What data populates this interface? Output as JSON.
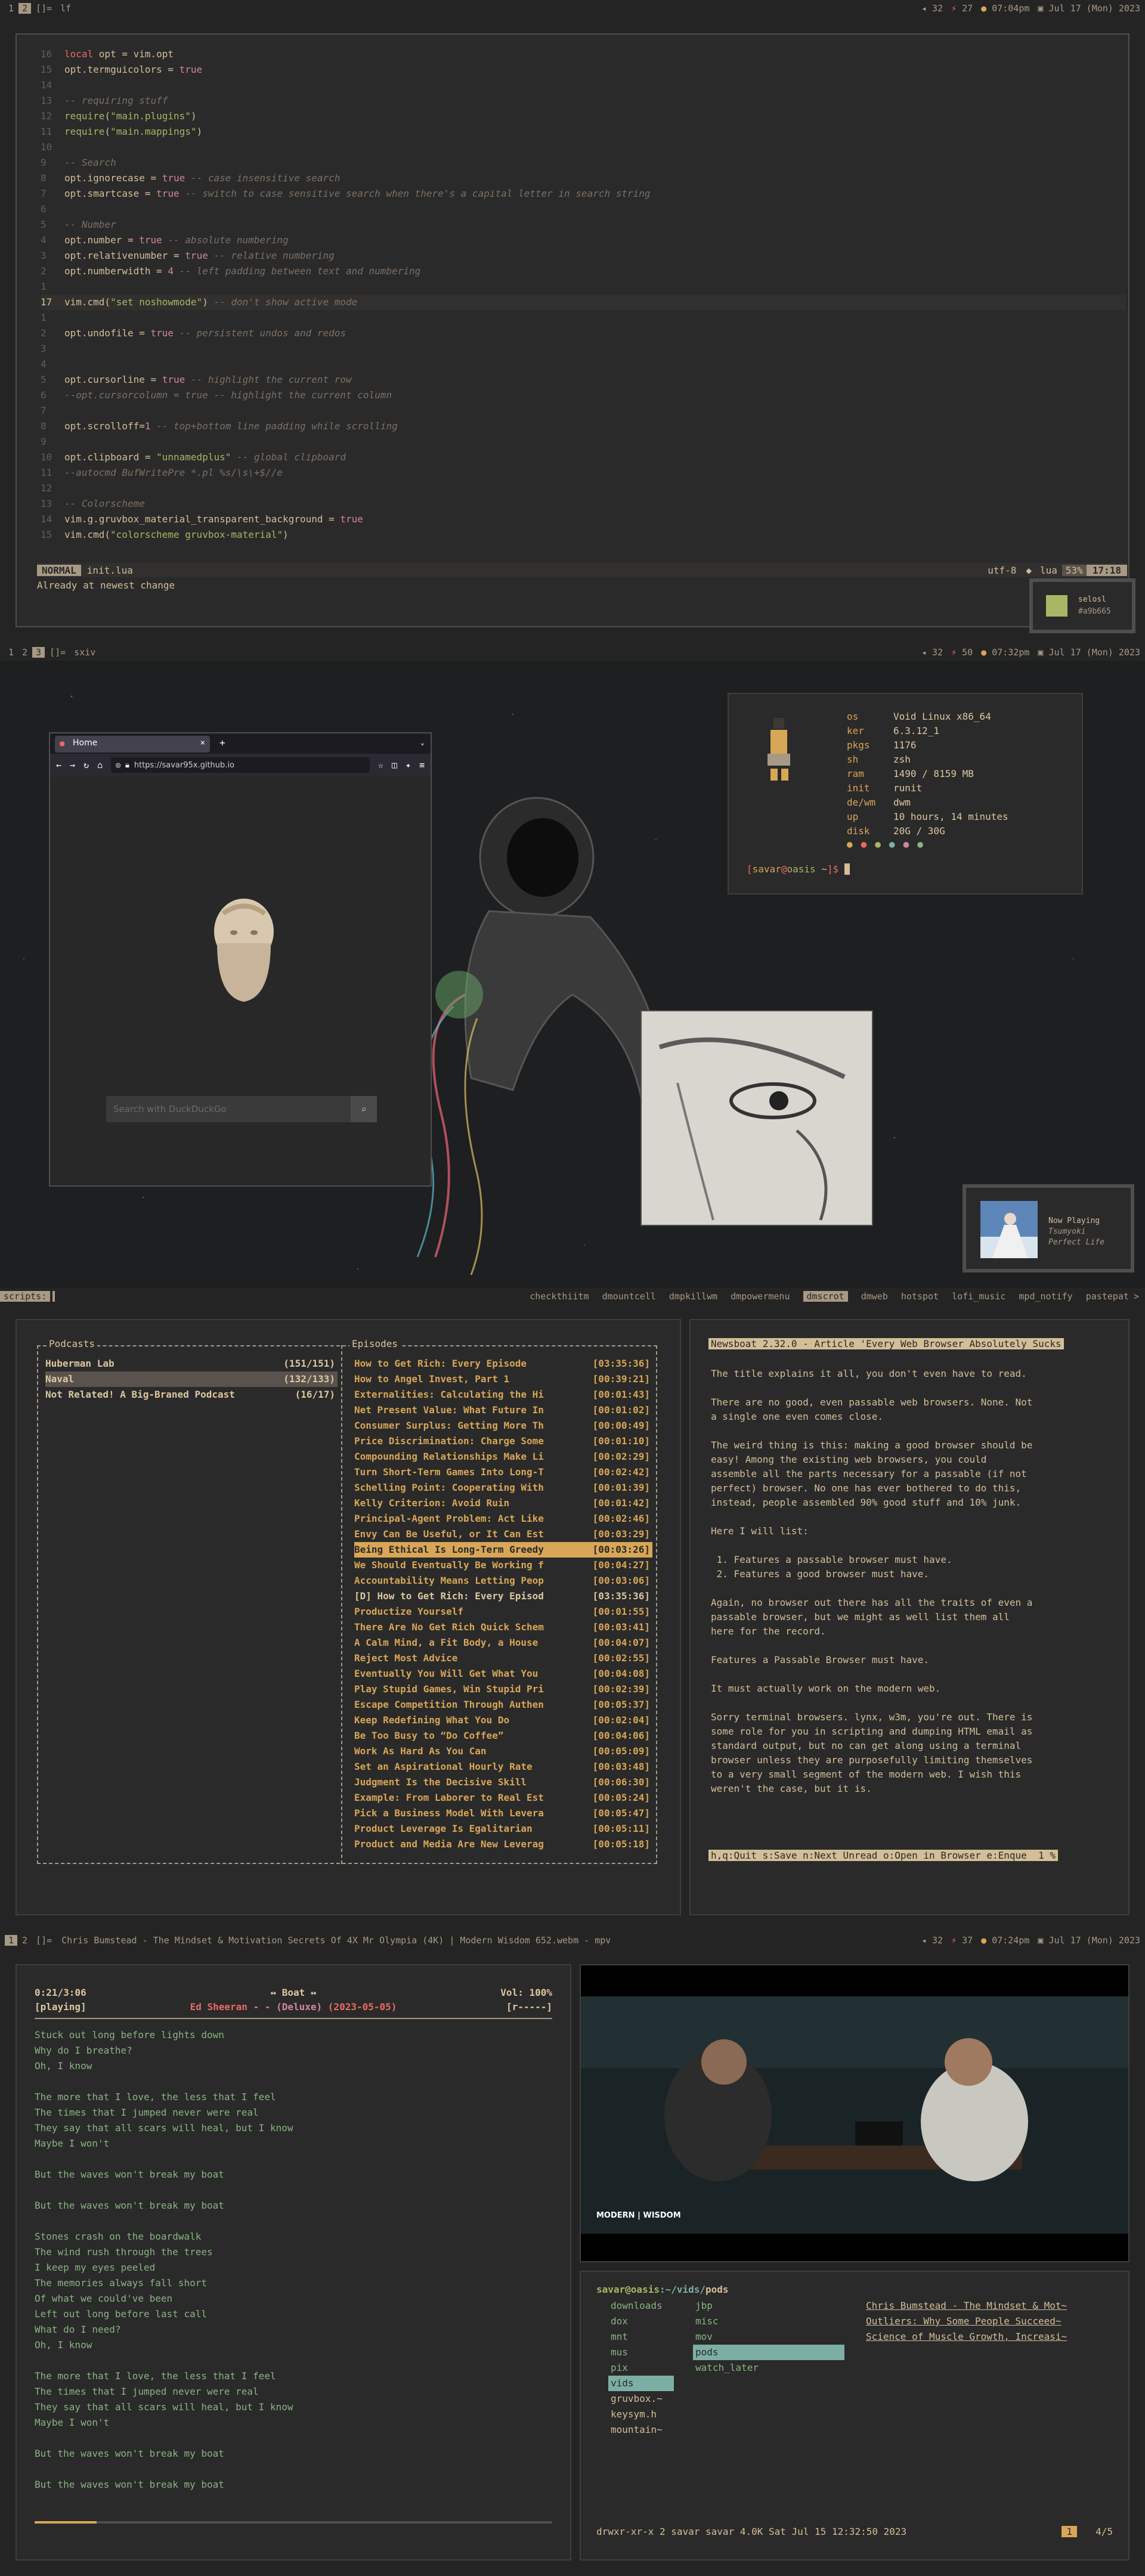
{
  "bar1": {
    "tags": [
      "1",
      "2",
      "[]=",
      "lf"
    ],
    "active": 1,
    "updates": "32",
    "cpu": "27",
    "time": "07:04pm",
    "date": "Jul 17 (Mon) 2023"
  },
  "nvim": {
    "lines": [
      {
        "n": "16",
        "t": [
          [
            "kw",
            "local "
          ],
          [
            "tx",
            "opt = vim.opt"
          ]
        ]
      },
      {
        "n": "15",
        "t": [
          [
            "tx",
            "opt.termguicolors = "
          ],
          [
            "nm",
            "true"
          ]
        ]
      },
      {
        "n": "14",
        "t": []
      },
      {
        "n": "13",
        "t": [
          [
            "cm",
            "-- requiring stuff"
          ]
        ]
      },
      {
        "n": "12",
        "t": [
          [
            "fn",
            "require"
          ],
          [
            "tx",
            "("
          ],
          [
            "str",
            "\"main.plugins\""
          ],
          [
            "tx",
            ")"
          ]
        ]
      },
      {
        "n": "11",
        "t": [
          [
            "fn",
            "require"
          ],
          [
            "tx",
            "("
          ],
          [
            "str",
            "\"main.mappings\""
          ],
          [
            "tx",
            ")"
          ]
        ]
      },
      {
        "n": "10",
        "t": []
      },
      {
        "n": "9",
        "t": [
          [
            "cm",
            "-- Search"
          ]
        ]
      },
      {
        "n": "8",
        "t": [
          [
            "tx",
            "opt.ignorecase = "
          ],
          [
            "nm",
            "true"
          ],
          [
            "cm",
            " -- case insensitive search"
          ]
        ]
      },
      {
        "n": "7",
        "t": [
          [
            "tx",
            "opt.smartcase = "
          ],
          [
            "nm",
            "true"
          ],
          [
            "cm",
            " -- switch to case sensitive search when there's a capital letter in search string"
          ]
        ]
      },
      {
        "n": "6",
        "t": []
      },
      {
        "n": "5",
        "t": [
          [
            "cm",
            "-- Number"
          ]
        ]
      },
      {
        "n": "4",
        "t": [
          [
            "tx",
            "opt.number = "
          ],
          [
            "nm",
            "true"
          ],
          [
            "cm",
            " -- absolute numbering"
          ]
        ]
      },
      {
        "n": "3",
        "t": [
          [
            "tx",
            "opt.relativenumber = "
          ],
          [
            "nm",
            "true"
          ],
          [
            "cm",
            " -- relative numbering"
          ]
        ]
      },
      {
        "n": "2",
        "t": [
          [
            "tx",
            "opt.numberwidth = "
          ],
          [
            "nm",
            "4"
          ],
          [
            "cm",
            " -- left padding between text and numbering"
          ]
        ]
      },
      {
        "n": "1",
        "t": []
      },
      {
        "n": "17",
        "t": [
          [
            "tx",
            "vim.cmd("
          ],
          [
            "str",
            "\"set noshowmode\""
          ],
          [
            "tx",
            ")"
          ],
          [
            "cm",
            " -- don't show active mode"
          ]
        ]
      },
      {
        "n": "1",
        "t": []
      },
      {
        "n": "2",
        "t": [
          [
            "tx",
            "opt.undofile = "
          ],
          [
            "nm",
            "true"
          ],
          [
            "cm",
            " -- persistent undos and redos"
          ]
        ]
      },
      {
        "n": "3",
        "t": []
      },
      {
        "n": "4",
        "t": []
      },
      {
        "n": "5",
        "t": [
          [
            "tx",
            "opt.cursorline = "
          ],
          [
            "nm",
            "true"
          ],
          [
            "cm",
            " -- highlight the current row"
          ]
        ]
      },
      {
        "n": "6",
        "t": [
          [
            "cm",
            "--opt.cursorcolumn = true -- highlight the current column"
          ]
        ]
      },
      {
        "n": "7",
        "t": []
      },
      {
        "n": "8",
        "t": [
          [
            "tx",
            "opt.scrolloff="
          ],
          [
            "nm",
            "1"
          ],
          [
            "cm",
            " -- top+bottom line padding while scrolling"
          ]
        ]
      },
      {
        "n": "9",
        "t": []
      },
      {
        "n": "10",
        "t": [
          [
            "tx",
            "opt.clipboard = "
          ],
          [
            "str",
            "\"unnamedplus\""
          ],
          [
            "cm",
            " -- global clipboard"
          ]
        ]
      },
      {
        "n": "11",
        "t": [
          [
            "cm",
            "--autocmd BufWritePre *.pl %s/\\s\\+$//e"
          ]
        ]
      },
      {
        "n": "12",
        "t": []
      },
      {
        "n": "13",
        "t": [
          [
            "cm",
            "-- Colorscheme"
          ]
        ]
      },
      {
        "n": "14",
        "t": [
          [
            "tx",
            "vim.g.gruvbox_material_transparent_background = "
          ],
          [
            "nm",
            "true"
          ]
        ]
      },
      {
        "n": "15",
        "t": [
          [
            "tx",
            "vim.cmd("
          ],
          [
            "str",
            "\"colorscheme gruvbox-material\""
          ],
          [
            "tx",
            ")"
          ]
        ]
      }
    ],
    "mode": "NORMAL",
    "file": "init.lua",
    "enc": "utf-8",
    "ft": "lua",
    "pct": "53%",
    "pos": "17:18",
    "msg": "Already at newest change"
  },
  "colorpicker": {
    "name": "selosl",
    "hex": "#a9b665",
    "swatch": "#a9b665"
  },
  "bar2": {
    "tags": [
      "1",
      "2",
      "3",
      "[]=",
      "sxiv"
    ],
    "active": 2,
    "updates": "32",
    "cpu": "50",
    "time": "07:32pm",
    "date": "Jul 17 (Mon) 2023"
  },
  "browser": {
    "tab": "Home",
    "url": "https://savar95x.github.io",
    "search_placeholder": "Search with DuckDuckGo"
  },
  "fetch": {
    "rows": [
      [
        "os",
        "Void Linux x86_64"
      ],
      [
        "ker",
        "6.3.12_1"
      ],
      [
        "pkgs",
        "1176"
      ],
      [
        "sh",
        "zsh"
      ],
      [
        "ram",
        "1490 / 8159 MB"
      ],
      [
        "init",
        "runit"
      ],
      [
        "de/wm",
        "dwm"
      ],
      [
        "up",
        "10 hours, 14 minutes"
      ],
      [
        "disk",
        "20G / 30G"
      ]
    ],
    "prompt_user": "savar",
    "prompt_host": "oasis",
    "prompt_path": "~"
  },
  "nowplaying": {
    "label": "Now Playing",
    "artist": "Tsumyoki",
    "title": "Perfect Life"
  },
  "scripts": {
    "prompt": "scripts:",
    "items": [
      "checkthiitm",
      "dmountcell",
      "dmpkillwm",
      "dmpowermenu",
      "dmscrot",
      "dmweb",
      "hotspot",
      "lofi_music",
      "mpd_notify",
      "pastepat"
    ],
    "selected": 4,
    "more": ">"
  },
  "podcasts": {
    "title": "Podcasts",
    "items": [
      {
        "name": "Huberman Lab",
        "count": "(151/151)"
      },
      {
        "name": "Naval",
        "count": "(132/133)"
      },
      {
        "name": "Not Related! A Big-Braned Podcast",
        "count": "(16/17)"
      }
    ],
    "episodes_title": "Episodes",
    "episodes": [
      [
        "How to Get Rich: Every Episode",
        "[03:35:36]"
      ],
      [
        "How to Angel Invest, Part 1",
        "[00:39:21]"
      ],
      [
        "Externalities: Calculating the Hi",
        "[00:01:43]"
      ],
      [
        "Net Present Value: What Future In",
        "[00:01:02]"
      ],
      [
        "Consumer Surplus: Getting More Th",
        "[00:00:49]"
      ],
      [
        "Price Discrimination: Charge Some",
        "[00:01:10]"
      ],
      [
        "Compounding Relationships Make Li",
        "[00:02:29]"
      ],
      [
        "Turn Short-Term Games Into Long-T",
        "[00:02:42]"
      ],
      [
        "Schelling Point: Cooperating With",
        "[00:01:39]"
      ],
      [
        "Kelly Criterion: Avoid Ruin",
        "[00:01:42]"
      ],
      [
        "Principal-Agent Problem: Act Like",
        "[00:02:46]"
      ],
      [
        "Envy Can Be Useful, or It Can Est",
        "[00:03:29]"
      ],
      [
        "Being Ethical Is Long-Term Greedy",
        "[00:03:26]"
      ],
      [
        "We Should Eventually Be Working f",
        "[00:04:27]"
      ],
      [
        "Accountability Means Letting Peop",
        "[00:03:06]"
      ],
      [
        "[D] How to Get Rich: Every Episod",
        "[03:35:36]"
      ],
      [
        "Productize Yourself",
        "[00:01:55]"
      ],
      [
        "There Are No Get Rich Quick Schem",
        "[00:03:41]"
      ],
      [
        "A Calm Mind, a Fit Body, a House",
        "[00:04:07]"
      ],
      [
        "Reject Most Advice",
        "[00:02:55]"
      ],
      [
        "Eventually You Will Get What You",
        "[00:04:08]"
      ],
      [
        "Play Stupid Games, Win Stupid Pri",
        "[00:02:39]"
      ],
      [
        "Escape Competition Through Authen",
        "[00:05:37]"
      ],
      [
        "Keep Redefining What You Do",
        "[00:02:04]"
      ],
      [
        "Be Too Busy to “Do Coffee”",
        "[00:04:06]"
      ],
      [
        "Work As Hard As You Can",
        "[00:05:09]"
      ],
      [
        "Set an Aspirational Hourly Rate",
        "[00:03:48]"
      ],
      [
        "Judgment Is the Decisive Skill",
        "[00:06:30]"
      ],
      [
        "Example: From Laborer to Real Est",
        "[00:05:24]"
      ],
      [
        "Pick a Business Model With Levera",
        "[00:05:47]"
      ],
      [
        "Product Leverage Is Egalitarian",
        "[00:05:11]"
      ],
      [
        "Product and Media Are New Leverag",
        "[00:05:18]"
      ]
    ]
  },
  "article": {
    "header": "Newsboat 2.32.0 - Article 'Every Web Browser Absolutely Sucks",
    "paras": [
      "The title explains it all, you don't even have to read.",
      "There are no good, even passable web browsers. None. Not\na single one even comes close.",
      "The weird thing is this: making a good browser should be\neasy! Among the existing web browsers, you could\nassemble all the parts necessary for a passable (if not\nperfect) browser. No one has ever bothered to do this,\ninstead, people assembled 90% good stuff and 10% junk.",
      "Here I will list:",
      " 1. Features a passable browser must have.\n 2. Features a good browser must have.",
      "Again, no browser out there has all the traits of even a\npassable browser, but we might as well list them all\nhere for the record.",
      "Features a Passable Browser must have.",
      "It must actually work on the modern web.",
      "Sorry terminal browsers. lynx, w3m, you're out. There is\nsome role for you in scripting and dumping HTML email as\nstandard output, but no can get along using a terminal\nbrowser unless they are purposefully limiting themselves\nto a very small segment of the modern web. I wish this\nweren't the case, but it is."
    ],
    "footer": "h,q:Quit s:Save n:Next Unread o:Open in Browser e:Enque  1 %"
  },
  "bar3": {
    "tags": [
      "1",
      "2",
      "[]="
    ],
    "active": 0,
    "title": "Chris Bumstead - The Mindset & Motivation Secrets Of 4X Mr Olympia (4K) | Modern Wisdom 652.webm - mpv",
    "updates": "32",
    "cpu": "37",
    "time": "07:24pm",
    "date": "Jul 17 (Mon) 2023"
  },
  "player": {
    "elapsed": "0:21/3:06",
    "state": "[playing]",
    "album_mode": "↔ Boat ↔",
    "artist": "Ed Sheeran",
    "album": "- - (Deluxe)",
    "year": "(2023-05-05)",
    "vol": "Vol: 100%",
    "flags": "[r-----]",
    "lyrics": "Stuck out long before lights down\nWhy do I breathe?\nOh, I know\n\nThe more that I love, the less that I feel\nThe times that I jumped never were real\nThey say that all scars will heal, but I know\nMaybe I won't\n\nBut the waves won't break my boat\n\nBut the waves won't break my boat\n\nStones crash on the boardwalk\nThe wind rush through the trees\nI keep my eyes peeled\nThe memories always fall short\nOf what we could've been\nLeft out long before last call\nWhat do I need?\nOh, I know\n\nThe more that I love, the less that I feel\nThe times that I jumped never were real\nThey say that all scars will heal, but I know\nMaybe I won't\n\nBut the waves won't break my boat\n\nBut the waves won't break my boat",
    "progress": 0.12
  },
  "video": {
    "watermark": "MODERN | WISDOM"
  },
  "lf": {
    "path_user": "savar@oasis",
    "path": ":~/vids/",
    "path_cur": "pods",
    "col1": [
      "downloads",
      "dox",
      "mnt",
      "mus",
      "pix",
      "vids",
      "gruvbox.~",
      "keysym.h",
      "mountain~"
    ],
    "col1_sel": 5,
    "col2": [
      "jbp",
      "misc",
      "mov",
      "pods",
      "watch_later"
    ],
    "col2_sel": 3,
    "col3": [
      "Chris Bumstead - The Mindset & Mot~",
      "Outliers: Why Some People Succeed~",
      "Science of Muscle Growth, Increasi~"
    ],
    "status": "drwxr-xr-x 2 savar savar 4.0K Sat Jul 15 12:32:50 2023",
    "tab": "1",
    "count": "4/5"
  }
}
